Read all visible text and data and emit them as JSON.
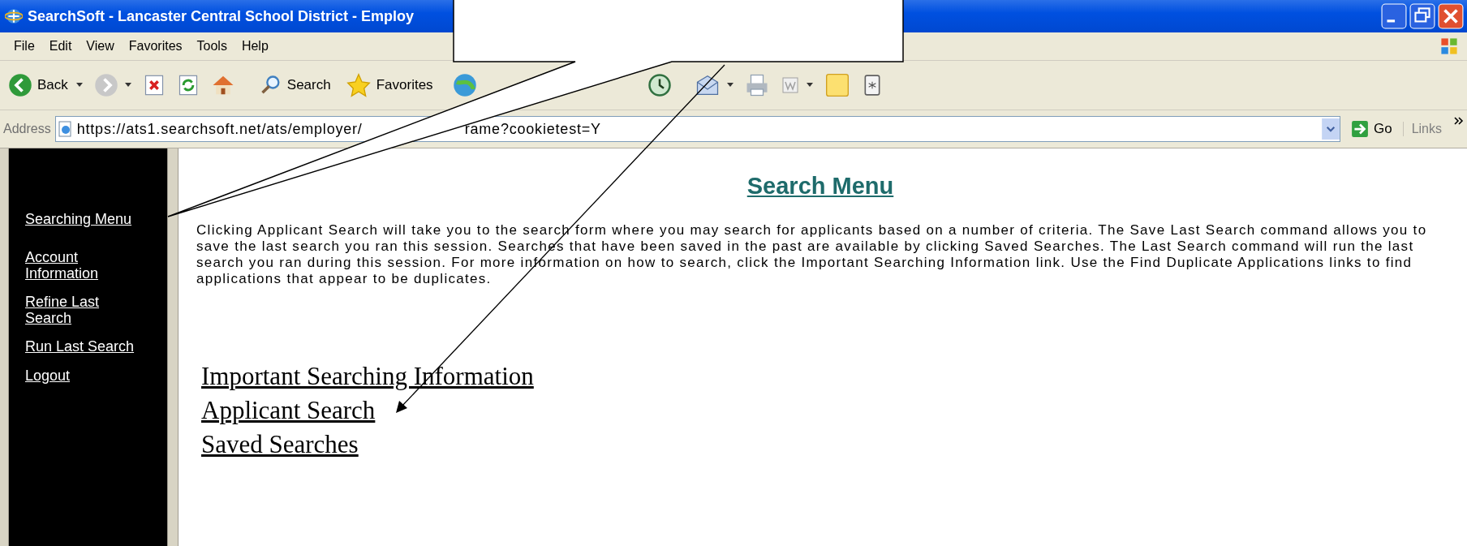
{
  "window": {
    "title": "SearchSoft - Lancaster Central School District - Employ"
  },
  "menu": [
    "File",
    "Edit",
    "View",
    "Favorites",
    "Tools",
    "Help"
  ],
  "toolbar": [
    {
      "kind": "back",
      "label": "Back"
    },
    {
      "kind": "forward"
    },
    {
      "kind": "stop"
    },
    {
      "kind": "refresh"
    },
    {
      "kind": "home"
    },
    {
      "kind": "search",
      "label": "Search"
    },
    {
      "kind": "favorites",
      "label": "Favorites"
    },
    {
      "kind": "media"
    },
    {
      "kind": "history"
    },
    {
      "kind": "mail"
    },
    {
      "kind": "print"
    },
    {
      "kind": "edit"
    },
    {
      "kind": "note"
    },
    {
      "kind": "messenger"
    }
  ],
  "address_bar": {
    "label": "Address",
    "value_start": "https://ats1.searchsoft.net/ats/employer/",
    "value_end": "rame?cookietest=Y",
    "go": "Go",
    "links": "Links"
  },
  "sidebar": {
    "items": [
      "Searching Menu",
      "Account Information",
      "Refine Last Search",
      "Run Last Search",
      "Logout"
    ]
  },
  "content": {
    "heading": "Search Menu",
    "description": "Clicking Applicant Search will take you to the search form where you may search for applicants based on a number of criteria.  The Save Last Search command allows you to save the last search you ran this session.  Searches that have been saved in the past are available by clicking Saved Searches.  The Last Search command will run the last search you ran during this session.  For more information on how to search, click the Important Searching Information link.  Use the Find Duplicate Applications links to find applications that appear to be duplicates.",
    "links": [
      "Important Searching Information",
      "Applicant Search",
      "Saved Searches"
    ]
  }
}
